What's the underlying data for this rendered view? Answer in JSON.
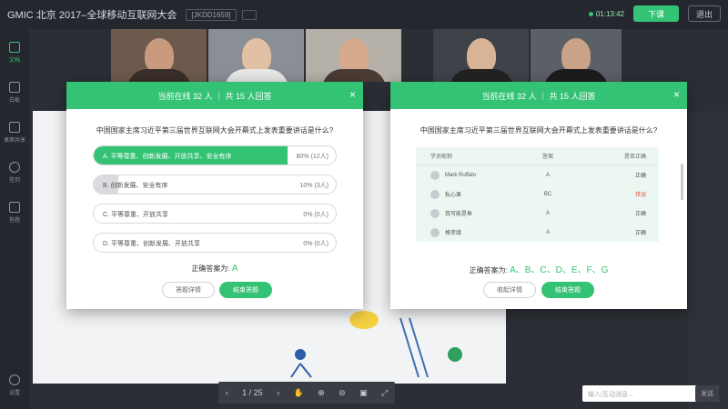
{
  "topbar": {
    "title": "GMIC 北京 2017–全球移动互联网大会",
    "room_id": "[JKDD1659]",
    "live_time": "01:13:42",
    "end_live_label": "下课",
    "exit_label": "退出"
  },
  "leftbar": {
    "items": [
      {
        "label": "文档",
        "icon": "document-icon",
        "active": true
      },
      {
        "label": "白板",
        "icon": "whiteboard-icon",
        "active": false
      },
      {
        "label": "桌面共享",
        "icon": "screen-share-icon",
        "active": false
      },
      {
        "label": "签到",
        "icon": "signin-icon",
        "active": false
      },
      {
        "label": "答题",
        "icon": "quiz-icon",
        "active": false
      },
      {
        "label": "设置",
        "icon": "settings-icon",
        "active": false
      }
    ]
  },
  "toolbar": {
    "page": "1 / 25"
  },
  "chat": {
    "input_placeholder": "输入/互动消息…",
    "send_label": "发送"
  },
  "modal_left": {
    "header": "当前在线 32 人 ｜ 共 15 人回答",
    "question": "中国国家主席习近平第三届世界互联网大会开幕式上发表重要讲话是什么?",
    "options": [
      {
        "label": "A. 平等尊重、创新发展、开放共享、安全有序",
        "stat": "80% (12人)",
        "fill": 0.8,
        "fill_color": "#34c274",
        "label_color": "#ffffff"
      },
      {
        "label": "B. 创新发展、安全有序",
        "stat": "10% (3人)",
        "fill": 0.1,
        "fill_color": "#d9dbde",
        "label_color": "#555555"
      },
      {
        "label": "C. 平等尊重、开放共享",
        "stat": "0% (0人)",
        "fill": 0,
        "fill_color": "#d9dbde",
        "label_color": "#555555"
      },
      {
        "label": "D. 平等尊重、创新发展、开放共享",
        "stat": "0% (0人)",
        "fill": 0,
        "fill_color": "#d9dbde",
        "label_color": "#555555"
      }
    ],
    "correct_label": "正确答案为:",
    "correct_value": "A",
    "details_btn": "答题详情",
    "end_btn": "结束答题"
  },
  "modal_right": {
    "header": "当前在线 32 人 ｜ 共 15 人回答",
    "question": "中国国家主席习近平第三届世界互联网大会开幕式上发表重要讲话是什么?",
    "columns": [
      "学员昵称",
      "答案",
      "是否正确"
    ],
    "rows": [
      {
        "name": "Mark Ruffalo",
        "answer": "A",
        "result": "正确",
        "correct": true
      },
      {
        "name": "私心果",
        "answer": "BC",
        "result": "错误",
        "correct": false
      },
      {
        "name": "我可能是鱼",
        "answer": "A",
        "result": "正确",
        "correct": true
      },
      {
        "name": "格菲缘",
        "answer": "A",
        "result": "正确",
        "correct": true
      }
    ],
    "correct_label": "正确答案为:",
    "correct_value": "A、B、C、D、E、F、G",
    "back_btn": "收起详情",
    "end_btn": "结束答题"
  }
}
